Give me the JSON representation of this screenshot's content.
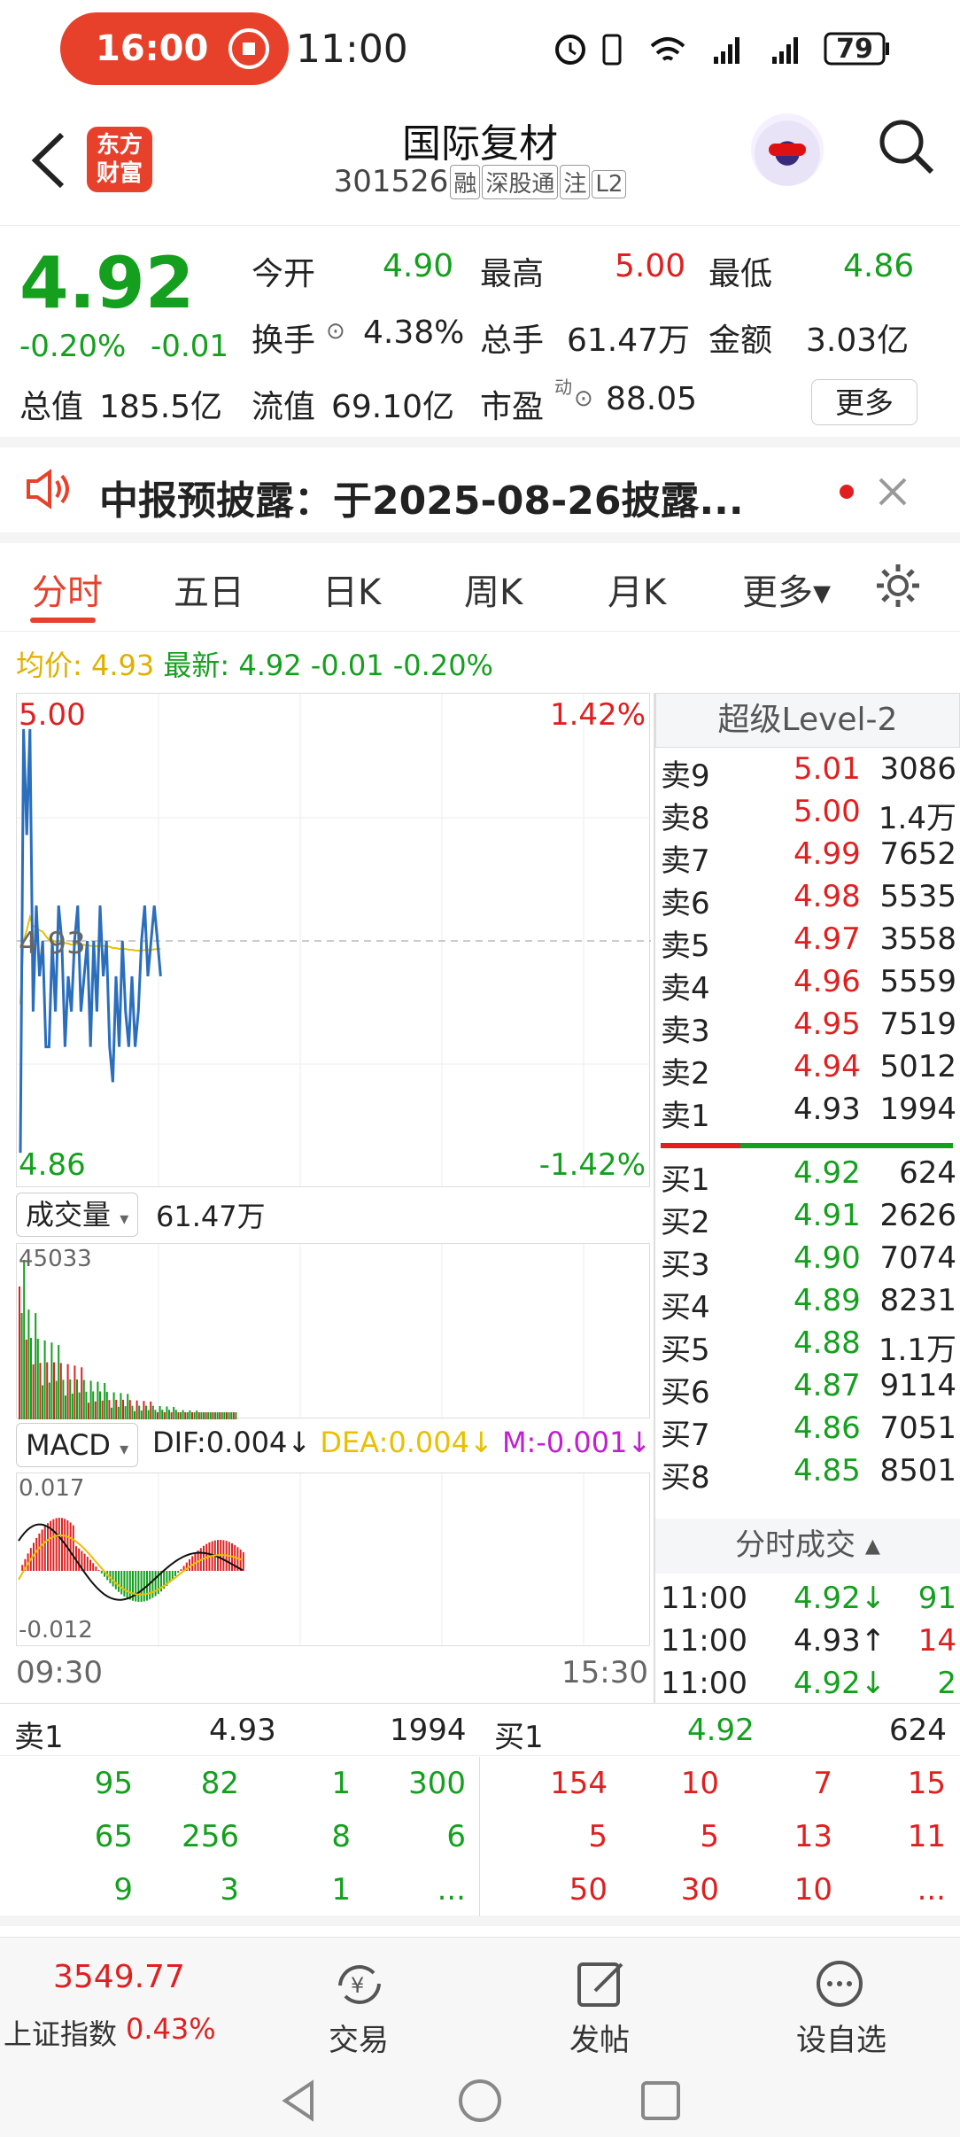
{
  "status": {
    "pill_time": "16:00",
    "clock": "11:00",
    "battery": "79"
  },
  "header": {
    "logo_line1": "东方",
    "logo_line2": "财富",
    "title": "国际复材",
    "code": "301526",
    "tags": [
      "融",
      "深股通",
      "注",
      "L2"
    ]
  },
  "quote": {
    "price": "4.92",
    "change_pct": "-0.20%",
    "change": "-0.01",
    "open_label": "今开",
    "open": "4.90",
    "high_label": "最高",
    "high": "5.00",
    "low_label": "最低",
    "low": "4.86",
    "turnover_label": "换手",
    "turnover": "4.38%",
    "volume_label": "总手",
    "volume": "61.47万",
    "amount_label": "金额",
    "amount": "3.03亿",
    "mktcap_label": "总值",
    "mktcap": "185.5亿",
    "float_label": "流值",
    "float": "69.10亿",
    "pe_label": "市盈",
    "pe_sup": "动",
    "pe": "88.05",
    "more": "更多"
  },
  "notice": {
    "text": "中报预披露：于2025-08-26披露..."
  },
  "tabs": [
    "分时",
    "五日",
    "日K",
    "周K",
    "月K",
    "更多▾"
  ],
  "avgline": {
    "avg_label": "均价:",
    "avg": "4.93",
    "latest_label": "最新:",
    "latest": "4.92",
    "chg": "-0.01",
    "pct": "-0.20%"
  },
  "chart": {
    "top_price": "5.00",
    "top_pct": "1.42%",
    "mid_price": "4.93",
    "bottom_price": "4.86",
    "bottom_pct": "-1.42%",
    "time_start": "09:30",
    "time_end": "15:30"
  },
  "volume": {
    "label": "成交量",
    "value": "61.47万",
    "max": "45033"
  },
  "macd": {
    "label": "MACD",
    "dif": "DIF:0.004",
    "dea": "DEA:0.004",
    "m": "M:-0.001",
    "top": "0.017",
    "bottom": "-0.012"
  },
  "chart_data": {
    "type": "line",
    "title": "",
    "price_range": [
      4.86,
      5.0
    ],
    "avg_price": 4.93,
    "prices": [
      4.87,
      4.99,
      4.96,
      4.99,
      4.91,
      4.94,
      4.92,
      4.93,
      4.9,
      4.9,
      4.93,
      4.91,
      4.94,
      4.93,
      4.9,
      4.92,
      4.91,
      4.93,
      4.94,
      4.91,
      4.92,
      4.93,
      4.9,
      4.93,
      4.91,
      4.94,
      4.92,
      4.93,
      4.9,
      4.89,
      4.92,
      4.9,
      4.93,
      4.91,
      4.9,
      4.92,
      4.9,
      4.91,
      4.93,
      4.94,
      4.92,
      4.93,
      4.94,
      4.93,
      4.92
    ],
    "volume_max": 45033
  },
  "level2": {
    "title": "超级Level-2",
    "asks": [
      {
        "l": "卖9",
        "p": "5.01",
        "v": "3086"
      },
      {
        "l": "卖8",
        "p": "5.00",
        "v": "1.4万"
      },
      {
        "l": "卖7",
        "p": "4.99",
        "v": "7652"
      },
      {
        "l": "卖6",
        "p": "4.98",
        "v": "5535"
      },
      {
        "l": "卖5",
        "p": "4.97",
        "v": "3558"
      },
      {
        "l": "卖4",
        "p": "4.96",
        "v": "5559"
      },
      {
        "l": "卖3",
        "p": "4.95",
        "v": "7519"
      },
      {
        "l": "卖2",
        "p": "4.94",
        "v": "5012"
      },
      {
        "l": "卖1",
        "p": "4.93",
        "v": "1994"
      }
    ],
    "bids": [
      {
        "l": "买1",
        "p": "4.92",
        "v": "624"
      },
      {
        "l": "买2",
        "p": "4.91",
        "v": "2626"
      },
      {
        "l": "买3",
        "p": "4.90",
        "v": "7074"
      },
      {
        "l": "买4",
        "p": "4.89",
        "v": "8231"
      },
      {
        "l": "买5",
        "p": "4.88",
        "v": "1.1万"
      },
      {
        "l": "买6",
        "p": "4.87",
        "v": "9114"
      },
      {
        "l": "买7",
        "p": "4.86",
        "v": "7051"
      },
      {
        "l": "买8",
        "p": "4.85",
        "v": "8501"
      }
    ],
    "ticks_title": "分时成交 ▴",
    "ticks": [
      {
        "t": "11:00",
        "p": "4.92↓",
        "v": "91"
      },
      {
        "t": "11:00",
        "p": "4.93↑",
        "v": "14"
      },
      {
        "t": "11:00",
        "p": "4.92↓",
        "v": "2"
      }
    ]
  },
  "book": {
    "sell_label": "卖1",
    "sell_price": "4.93",
    "sell_vol": "1994",
    "buy_label": "买1",
    "buy_price": "4.92",
    "buy_vol": "624",
    "sell_rows": [
      [
        "95",
        "82",
        "1",
        "300"
      ],
      [
        "65",
        "256",
        "8",
        "6"
      ],
      [
        "9",
        "3",
        "1",
        "..."
      ]
    ],
    "buy_rows": [
      [
        "154",
        "10",
        "7",
        "15"
      ],
      [
        "5",
        "5",
        "13",
        "11"
      ],
      [
        "50",
        "30",
        "10",
        "..."
      ]
    ]
  },
  "nav": {
    "index_value": "3549.77",
    "index_name": "上证指数",
    "index_pct": "0.43%",
    "trade": "交易",
    "post": "发帖",
    "watch": "设自选"
  }
}
